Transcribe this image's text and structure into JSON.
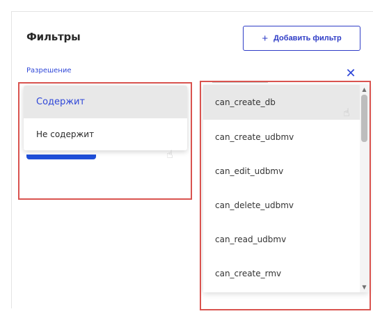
{
  "header": {
    "title": "Фильтры",
    "add_filter_label": "Добавить фильтр",
    "add_filter_icon": "plus-icon"
  },
  "filter": {
    "field_label": "Разрешение",
    "close_icon": "close-icon",
    "condition_options": [
      "Содержит",
      "Не содержит"
    ],
    "selected_condition": "Содержит"
  },
  "permissions_list": {
    "items": [
      "can_create_db",
      "can_create_udbmv",
      "can_edit_udbmv",
      "can_delete_udbmv",
      "can_read_udbmv",
      "can_create_rmv"
    ]
  },
  "colors": {
    "accent": "#2f47d8",
    "highlight_border": "#d9534f",
    "selected_bg": "#e8e8e8"
  }
}
